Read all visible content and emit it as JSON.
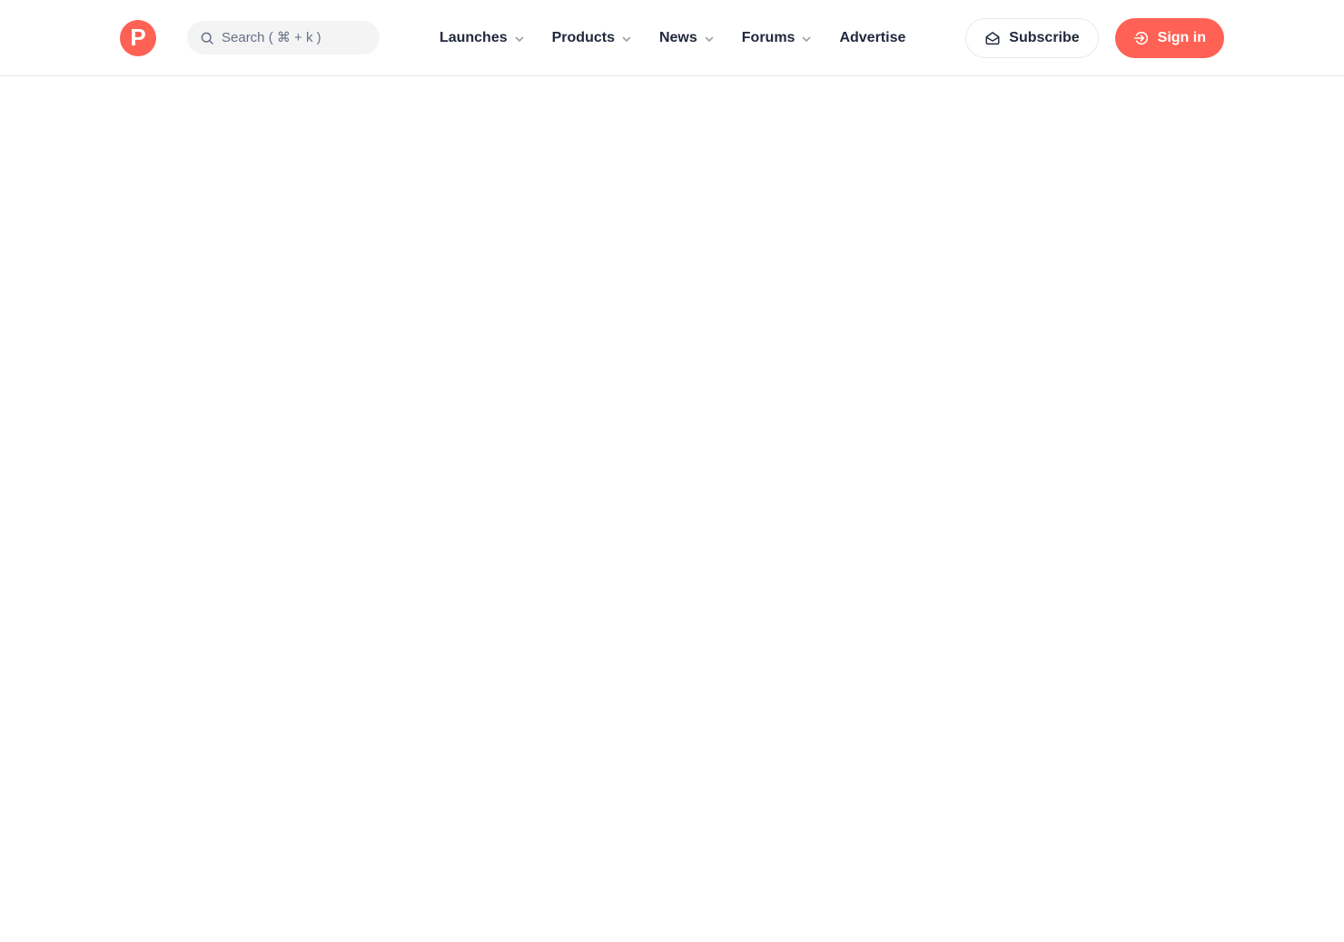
{
  "brand": {
    "name": "product-hunt-logo",
    "logo_letter": "P",
    "accent_color": "#ff6154"
  },
  "search": {
    "placeholder": "Search ( ⌘ + k )",
    "value": ""
  },
  "nav": {
    "items": [
      {
        "label": "Launches",
        "has_dropdown": true
      },
      {
        "label": "Products",
        "has_dropdown": true
      },
      {
        "label": "News",
        "has_dropdown": true
      },
      {
        "label": "Forums",
        "has_dropdown": true
      },
      {
        "label": "Advertise",
        "has_dropdown": false
      }
    ]
  },
  "actions": {
    "subscribe_label": "Subscribe",
    "sign_in_label": "Sign in"
  },
  "colors": {
    "brand_coral": "#ff6154",
    "nav_text": "#21293c",
    "muted_gray": "#667085",
    "chevron_gray": "#9aa1ad",
    "search_bg": "#f4f4f5",
    "header_border": "#e8e8ec"
  }
}
